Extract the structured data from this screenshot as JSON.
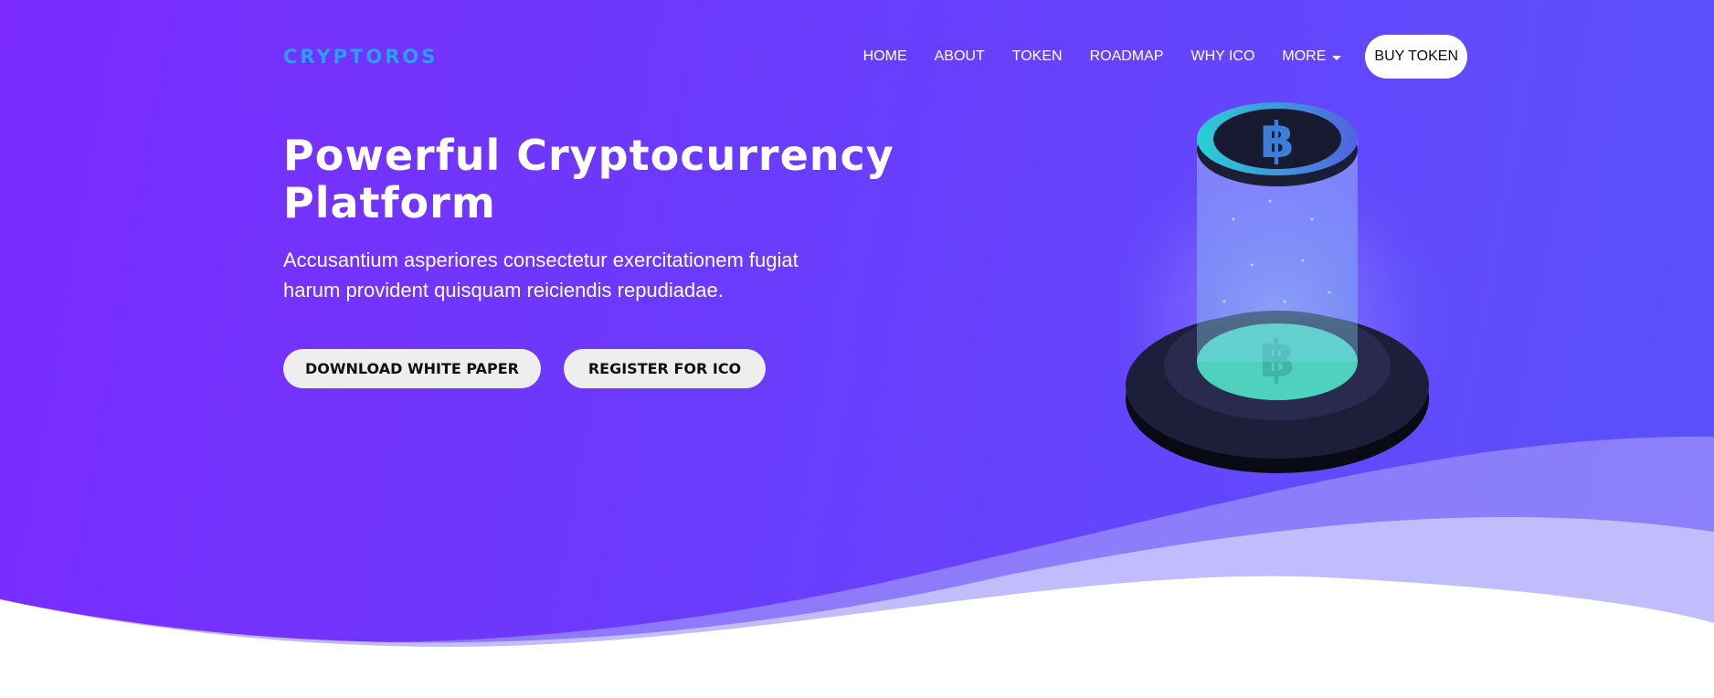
{
  "nav": {
    "brand": "CRYPTOROS",
    "items": [
      {
        "label": "HOME"
      },
      {
        "label": "ABOUT"
      },
      {
        "label": "TOKEN"
      },
      {
        "label": "ROADMAP"
      },
      {
        "label": "WHY ICO"
      },
      {
        "label": "MORE"
      }
    ],
    "buy_label": "BUY TOKEN"
  },
  "hero": {
    "title_line1": "Powerful Cryptocurrency",
    "title_line2": "Platform",
    "lead_line1": "Accusantium asperiores consectetur exercitationem fugiat",
    "lead_line2": "harum provident quisquam reiciendis repudiadae.",
    "download_label": "DOWNLOAD WHITE PAPER",
    "register_label": "REGISTER FOR ICO"
  },
  "colors": {
    "gradient_start": "#7b2bfd",
    "gradient_end": "#5a52fb",
    "brand": "#2aa0f0",
    "accent": "#4fd1c0"
  },
  "icons": {
    "illustration": "bitcoin-pedestal-illustration",
    "coin": "bitcoin-icon",
    "dropdown": "caret-down-icon"
  }
}
